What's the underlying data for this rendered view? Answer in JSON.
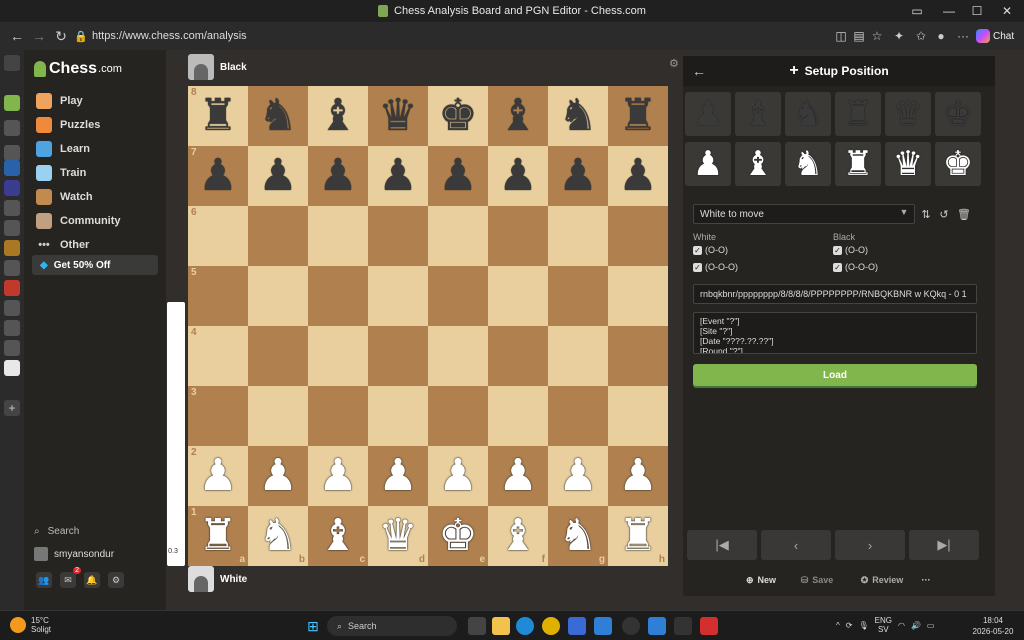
{
  "window": {
    "title": "Chess Analysis Board and PGN Editor - Chess.com"
  },
  "browser": {
    "url": "https://www.chess.com/analysis",
    "chat_label": "Chat"
  },
  "nav": {
    "logo_text": "Chess",
    "logo_suffix": ".com",
    "items": [
      {
        "label": "Play",
        "icon": "hand-piece-icon",
        "color": "#f0a35e"
      },
      {
        "label": "Puzzles",
        "icon": "puzzle-icon",
        "color": "#f08a3a"
      },
      {
        "label": "Learn",
        "icon": "graduation-cap-icon",
        "color": "#4fa3e0"
      },
      {
        "label": "Train",
        "icon": "train-icon",
        "color": "#9ad1f0"
      },
      {
        "label": "Watch",
        "icon": "binoculars-icon",
        "color": "#c28b4d"
      },
      {
        "label": "Community",
        "icon": "people-icon",
        "color": "#c0a080"
      },
      {
        "label": "Other",
        "icon": "dots-icon",
        "color": "#cccccc"
      }
    ],
    "promo": "Get 50% Off",
    "search_placeholder": "Search",
    "username": "smyansondur",
    "messages_badge": "2"
  },
  "players": {
    "top": "Black",
    "bottom": "White"
  },
  "eval": "0.3",
  "board": {
    "ranks": [
      "8",
      "7",
      "6",
      "5",
      "4",
      "3",
      "2",
      "1"
    ],
    "files": [
      "a",
      "b",
      "c",
      "d",
      "e",
      "f",
      "g",
      "h"
    ],
    "position": [
      [
        "r",
        "n",
        "b",
        "q",
        "k",
        "b",
        "n",
        "r"
      ],
      [
        "p",
        "p",
        "p",
        "p",
        "p",
        "p",
        "p",
        "p"
      ],
      [
        "",
        "",
        "",
        "",
        "",
        "",
        "",
        ""
      ],
      [
        "",
        "",
        "",
        "",
        "",
        "",
        "",
        ""
      ],
      [
        "",
        "",
        "",
        "",
        "",
        "",
        "",
        ""
      ],
      [
        "",
        "",
        "",
        "",
        "",
        "",
        "",
        ""
      ],
      [
        "P",
        "P",
        "P",
        "P",
        "P",
        "P",
        "P",
        "P"
      ],
      [
        "R",
        "N",
        "B",
        "Q",
        "K",
        "B",
        "N",
        "R"
      ]
    ]
  },
  "setup": {
    "title": "Setup Position",
    "black_pieces": [
      "p",
      "b",
      "n",
      "r",
      "q",
      "k"
    ],
    "white_pieces": [
      "P",
      "B",
      "N",
      "R",
      "Q",
      "K"
    ],
    "to_move": "White to move",
    "white_label": "White",
    "black_label": "Black",
    "castle_short": "(O-O)",
    "castle_long": "(O-O-O)",
    "fen": "rnbqkbnr/pppppppp/8/8/8/8/PPPPPPPP/RNBQKBNR w KQkq - 0 1",
    "pgn": "[Event \"?\"]\n[Site \"?\"]\n[Date \"????.??.??\"]\n[Round \"?\"]",
    "load_label": "Load",
    "new_label": "New",
    "save_label": "Save",
    "review_label": "Review"
  },
  "taskbar": {
    "temp": "15°C",
    "weather": "Soligt",
    "search": "Search",
    "lang1": "ENG",
    "lang2": "SV",
    "time": "18:04",
    "date": "2026-05-20"
  },
  "colors": {
    "accent": "#81b64c",
    "light_square": "#e9cf9d",
    "dark_square": "#b0814f"
  }
}
